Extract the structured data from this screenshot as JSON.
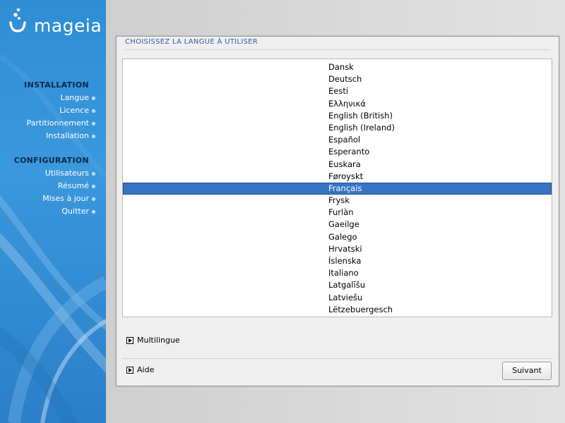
{
  "brand": {
    "name": "mageia"
  },
  "sidebar": {
    "sections": [
      {
        "heading": "INSTALLATION",
        "items": [
          "Langue",
          "Licence",
          "Partitionnement",
          "Installation"
        ]
      },
      {
        "heading": "CONFIGURATION",
        "items": [
          "Utilisateurs",
          "Résumé",
          "Mises à jour",
          "Quitter"
        ]
      }
    ]
  },
  "main": {
    "title": "CHOISISSEZ LA LANGUE À UTILISER",
    "languages": [
      "Dansk",
      "Deutsch",
      "Eesti",
      "Ελληνικά",
      "English (British)",
      "English (Ireland)",
      "Español",
      "Esperanto",
      "Euskara",
      "Føroyskt",
      "Français",
      "Frysk",
      "Furlàn",
      "Gaeilge",
      "Galego",
      "Hrvatski",
      "Íslenska",
      "Italiano",
      "Latgalīšu",
      "Latviešu",
      "Lëtzebuergesch"
    ],
    "selected_language": "Français",
    "multilingual_label": "Multilingue",
    "help_label": "Aide",
    "next_label": "Suivant"
  },
  "colors": {
    "sidebar_blue": "#2f8dd4",
    "selection": "#3574c5",
    "title_blue": "#2d5fa3"
  },
  "icons": {
    "logo": "mageia-bubbles-logo",
    "expander": "triangle-right-icon",
    "nav_bullet": "bullet-icon"
  }
}
